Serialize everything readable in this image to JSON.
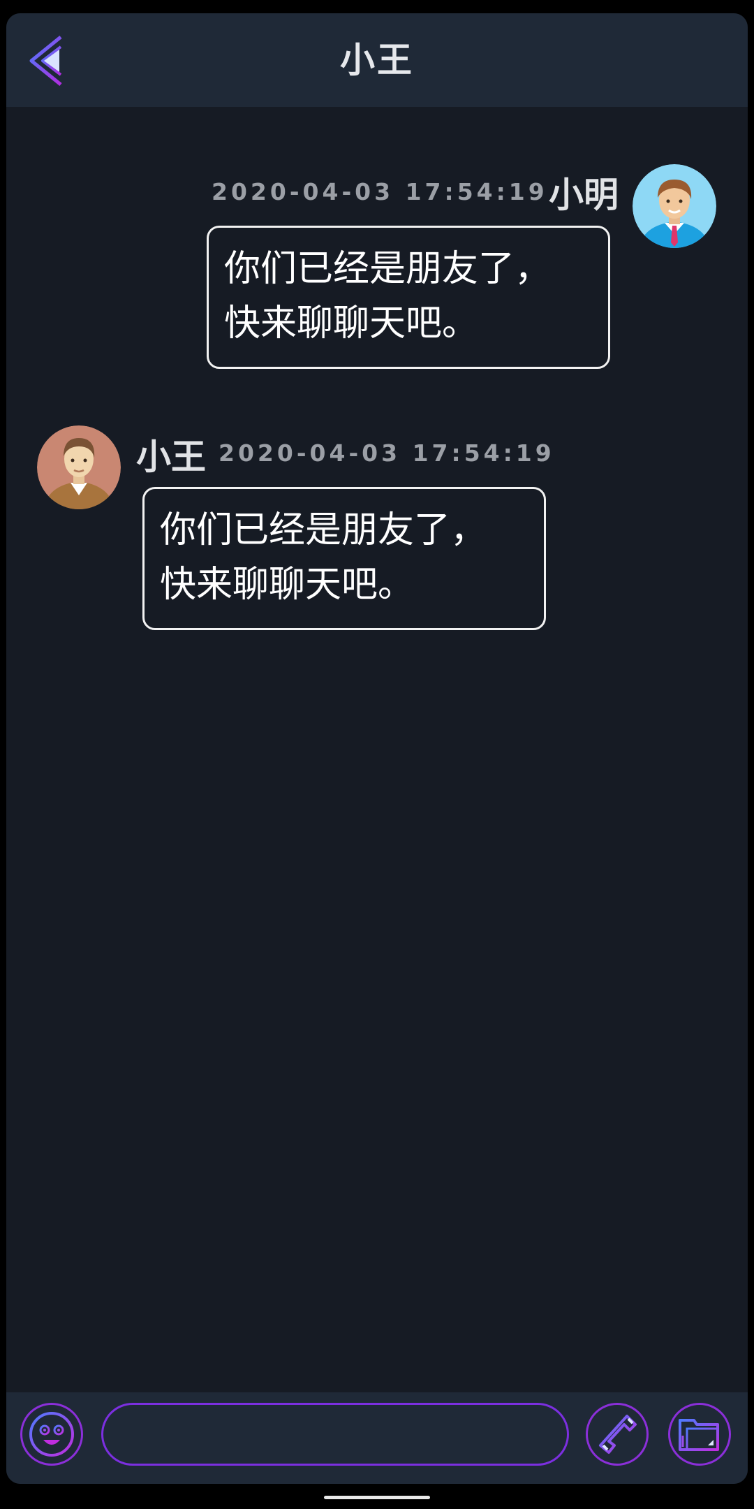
{
  "header": {
    "title": "小王",
    "back_icon": "chevron-left-icon"
  },
  "messages": [
    {
      "side": "right",
      "sender": "小明",
      "time": "2020-04-03 17:54:19",
      "text": "你们已经是朋友了，\n快来聊聊天吧。",
      "avatar_icon": "male-avatar-blue"
    },
    {
      "side": "left",
      "sender": "小王",
      "time": "2020-04-03 17:54:19",
      "text": "你们已经是朋友了，\n快来聊聊天吧。",
      "avatar_icon": "male-avatar-brown"
    }
  ],
  "input_bar": {
    "emoji_icon": "emoji-icon",
    "message_value": "",
    "phone_icon": "phone-icon",
    "folder_icon": "folder-icon"
  },
  "colors": {
    "background": "#161b24",
    "header_bg": "#1f2937",
    "accent_purple": "#8b2fd9",
    "accent_blue": "#4f7bff"
  }
}
